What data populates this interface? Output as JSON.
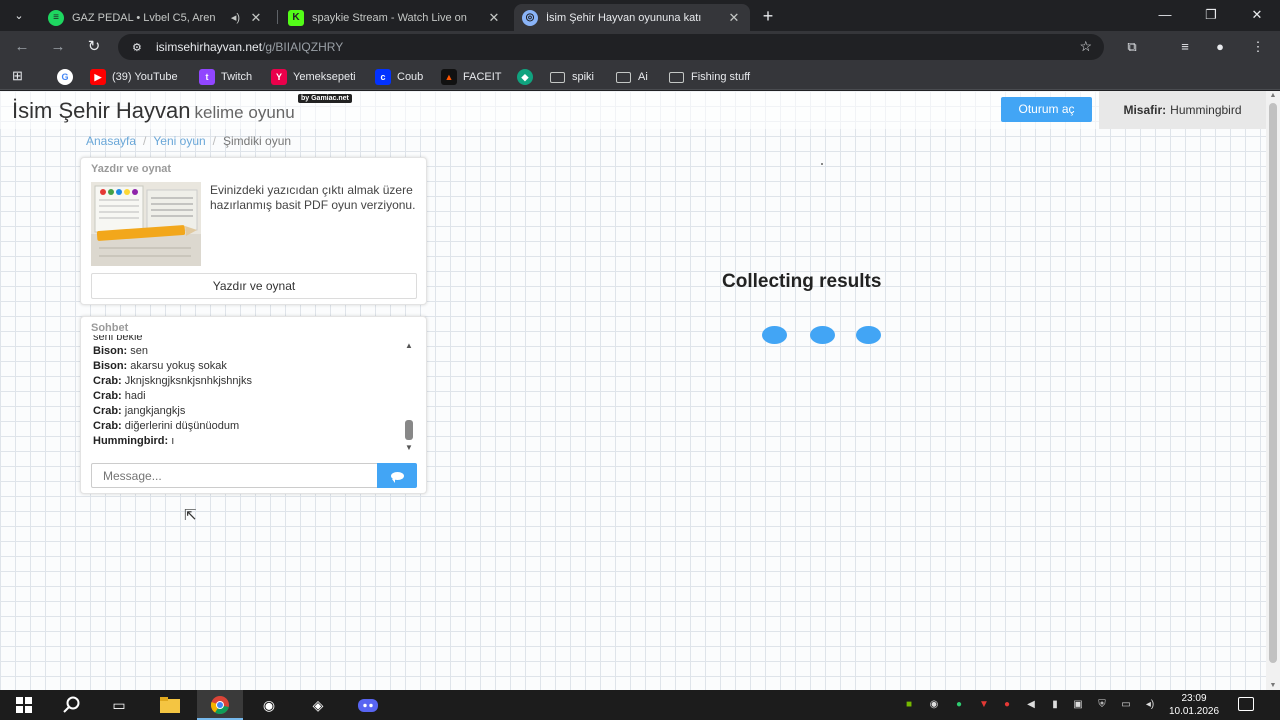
{
  "browser": {
    "tabs": [
      {
        "title": "GAZ PEDAL • Lvbel C5, Aren",
        "favicon": "spotify-icon",
        "color": "#1ed760"
      },
      {
        "title": "spaykie Stream - Watch Live on",
        "favicon": "kick-icon",
        "color": "#53fc18"
      },
      {
        "title": "İsim Şehir Hayvan oyununa katı",
        "favicon": "globe-icon",
        "color": "#8ab4f8"
      }
    ],
    "url_host": "isimsehirhayvan.net",
    "url_path": "/g/BIIAIQZHRY",
    "bookmarks": [
      {
        "label": "(39) YouTube",
        "icon": "youtube-icon",
        "color": "#ff0000"
      },
      {
        "label": "Twitch",
        "icon": "twitch-icon",
        "color": "#9146ff"
      },
      {
        "label": "Yemeksepeti",
        "icon": "yemeksepeti-icon",
        "color": "#ea004b"
      },
      {
        "label": "Coub",
        "icon": "coub-icon",
        "color": "#0332ff"
      },
      {
        "label": "FACEIT",
        "icon": "faceit-icon",
        "color": "#ff5500"
      },
      {
        "label": "spiki",
        "icon": "folder-icon"
      },
      {
        "label": "Ai",
        "icon": "folder-icon"
      },
      {
        "label": "Fishing stuff",
        "icon": "folder-icon"
      }
    ]
  },
  "site": {
    "logo_main": "İsim Şehir Hayvan",
    "logo_sub": "kelime oyunu",
    "logo_badge": "by Gamiac.net",
    "login_label": "Oturum aç",
    "guest_label": "Misafir:",
    "guest_name": "Hummingbird",
    "breadcrumb": [
      "Anasayfa",
      "Yeni oyun",
      "Şimdiki oyun"
    ]
  },
  "print_panel": {
    "title": "Yazdır ve oynat",
    "description": "Evinizdeki yazıcıdan çıktı almak üzere hazırlanmış basit PDF oyun verziyonu.",
    "button_label": "Yazdır ve oynat"
  },
  "chat": {
    "title": "Sohbet",
    "partial_first": "seni bekle",
    "messages": [
      {
        "user": "Bison:",
        "text": "sen"
      },
      {
        "user": "Bison:",
        "text": "akarsu yokuş sokak"
      },
      {
        "user": "Crab:",
        "text": "Jknjskngjksnkjsnhkjshnjks"
      },
      {
        "user": "Crab:",
        "text": "hadi"
      },
      {
        "user": "Crab:",
        "text": "jangkjangkjs"
      },
      {
        "user": "Crab:",
        "text": "diğerlerini düşünüodum"
      },
      {
        "user": "Hummingbird:",
        "text": "ı"
      }
    ],
    "input_placeholder": "Message..."
  },
  "status": {
    "text": "Collecting results",
    "accent": "#42a5f5"
  },
  "taskbar": {
    "time": "23:09",
    "date": "10.01.2026"
  }
}
